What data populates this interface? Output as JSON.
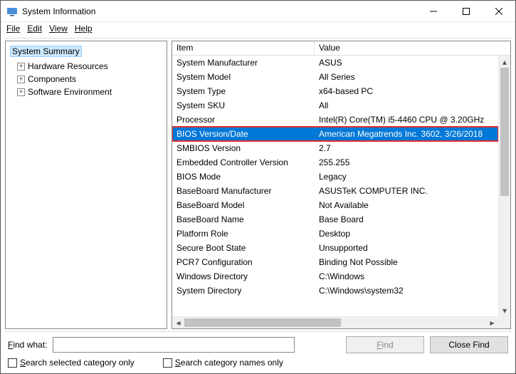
{
  "window": {
    "title": "System Information"
  },
  "menu": {
    "file": "File",
    "edit": "Edit",
    "view": "View",
    "help": "Help"
  },
  "tree": {
    "root": "System Summary",
    "children": [
      {
        "label": "Hardware Resources"
      },
      {
        "label": "Components"
      },
      {
        "label": "Software Environment"
      }
    ]
  },
  "columns": {
    "item": "Item",
    "value": "Value"
  },
  "selected_index": 5,
  "rows": [
    {
      "item": "System Manufacturer",
      "value": "ASUS"
    },
    {
      "item": "System Model",
      "value": "All Series"
    },
    {
      "item": "System Type",
      "value": "x64-based PC"
    },
    {
      "item": "System SKU",
      "value": "All"
    },
    {
      "item": "Processor",
      "value": "Intel(R) Core(TM) i5-4460  CPU @ 3.20GHz"
    },
    {
      "item": "BIOS Version/Date",
      "value": "American Megatrends Inc. 3602, 3/26/2018"
    },
    {
      "item": "SMBIOS Version",
      "value": "2.7"
    },
    {
      "item": "Embedded Controller Version",
      "value": "255.255"
    },
    {
      "item": "BIOS Mode",
      "value": "Legacy"
    },
    {
      "item": "BaseBoard Manufacturer",
      "value": "ASUSTeK COMPUTER INC."
    },
    {
      "item": "BaseBoard Model",
      "value": "Not Available"
    },
    {
      "item": "BaseBoard Name",
      "value": "Base Board"
    },
    {
      "item": "Platform Role",
      "value": "Desktop"
    },
    {
      "item": "Secure Boot State",
      "value": "Unsupported"
    },
    {
      "item": "PCR7 Configuration",
      "value": "Binding Not Possible"
    },
    {
      "item": "Windows Directory",
      "value": "C:\\Windows"
    },
    {
      "item": "System Directory",
      "value": "C:\\Windows\\system32"
    }
  ],
  "footer": {
    "find_label": "Find what:",
    "find_value": "",
    "find_btn": "Find",
    "close_find_btn": "Close Find",
    "chk1": "Search selected category only",
    "chk2": "Search category names only"
  }
}
